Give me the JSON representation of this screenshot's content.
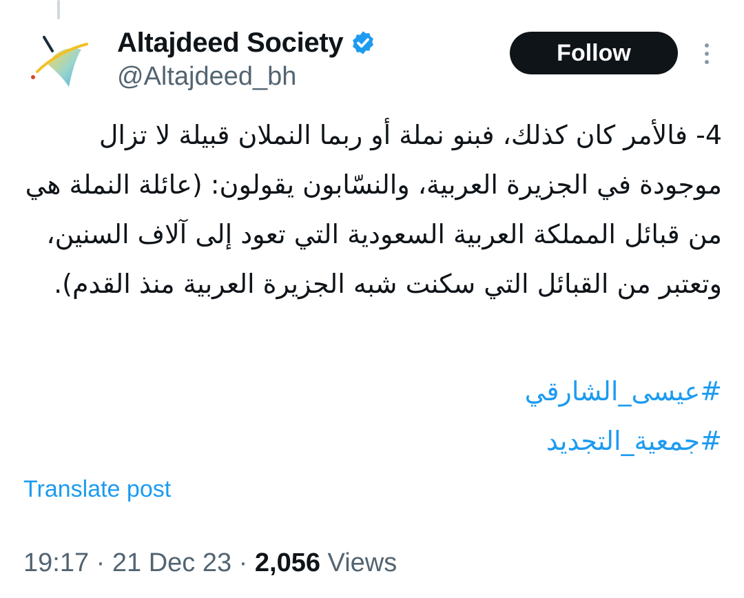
{
  "post": {
    "author": {
      "display_name": "Altajdeed Society",
      "handle": "@Altajdeed_bh",
      "verified": true
    },
    "follow_label": "Follow",
    "text": "4- فالأمر كان كذلك، فبنو نملة أو ربما النملان قبيلة لا تزال موجودة في الجزيرة العربية، والنسّابون يقولون: (عائلة النملة هي من قبائل المملكة العربية السعودية التي تعود إلى آلاف السنين، وتعتبر من القبائل التي سكنت شبه الجزيرة العربية منذ القدم).",
    "hashtags": [
      "#عيسى_الشارقي",
      "#جمعية_التجديد"
    ],
    "translate_label": "Translate post",
    "time": "19:17",
    "separator": "·",
    "date": "21 Dec 23",
    "views_count": "2,056",
    "views_label": "Views"
  },
  "colors": {
    "link": "#1d9bf0",
    "secondary_text": "#536471",
    "primary_text": "#0f1419",
    "button_bg": "#0f1419"
  },
  "icons": [
    "avatar-logo",
    "verified-badge-icon",
    "more-options-icon"
  ]
}
